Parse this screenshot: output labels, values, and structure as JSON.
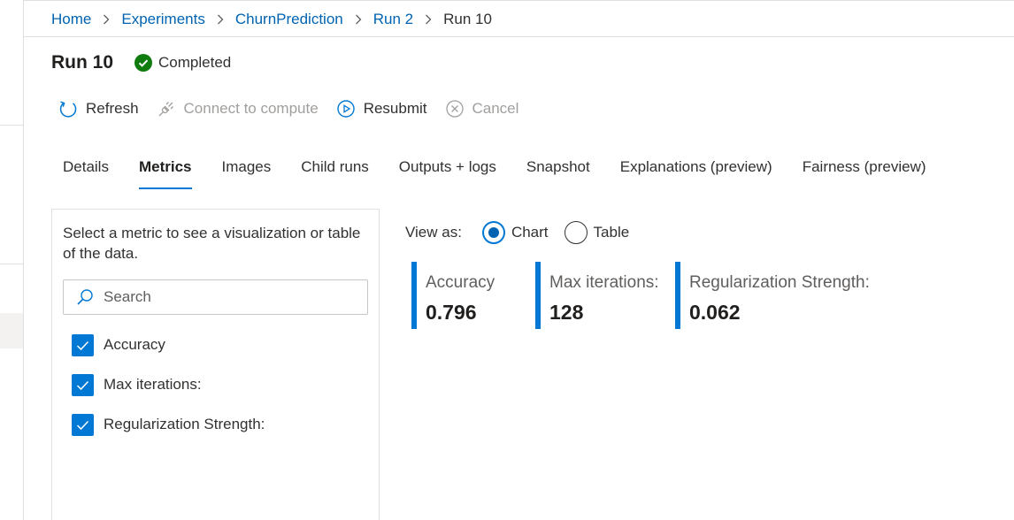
{
  "breadcrumb": [
    "Home",
    "Experiments",
    "ChurnPrediction",
    "Run 2",
    "Run 10"
  ],
  "title": "Run 10",
  "status": "Completed",
  "colors": {
    "accent": "#0078d4",
    "link": "#0063b1",
    "success": "#107c10"
  },
  "toolbar": {
    "refresh": "Refresh",
    "connect": "Connect to compute",
    "resubmit": "Resubmit",
    "cancel": "Cancel"
  },
  "tabs": [
    "Details",
    "Metrics",
    "Images",
    "Child runs",
    "Outputs + logs",
    "Snapshot",
    "Explanations (preview)",
    "Fairness (preview)"
  ],
  "active_tab": "Metrics",
  "panel": {
    "description": "Select a metric to see a visualization or table of the data.",
    "search_placeholder": "Search",
    "metrics": [
      "Accuracy",
      "Max iterations:",
      "Regularization Strength:"
    ]
  },
  "view_as": {
    "label": "View as:",
    "options": [
      "Chart",
      "Table"
    ],
    "selected": "Chart"
  },
  "cards": [
    {
      "name": "Accuracy",
      "value": "0.796"
    },
    {
      "name": "Max iterations:",
      "value": "128"
    },
    {
      "name": "Regularization Strength:",
      "value": "0.062"
    }
  ]
}
